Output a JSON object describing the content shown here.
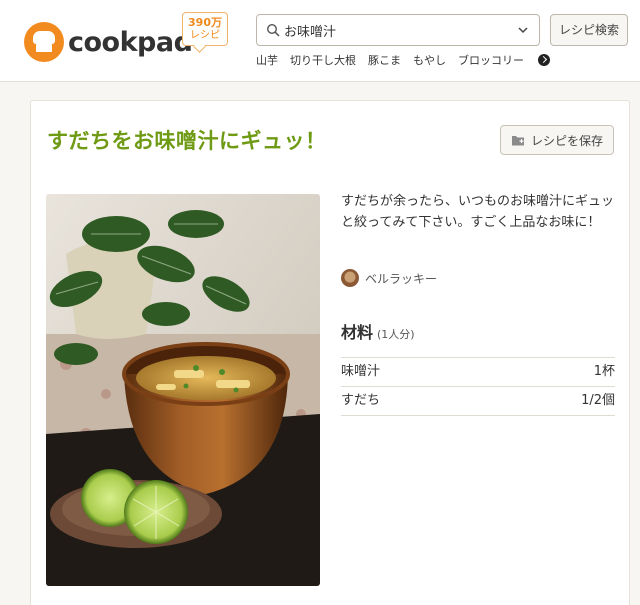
{
  "header": {
    "logo_text": "cookpad",
    "badge_line1": "390万",
    "badge_line2": "レシピ",
    "search_value": "お味噌汁",
    "search_button": "レシピ検索",
    "keywords": [
      "山芋",
      "切り干し大根",
      "豚こま",
      "もやし",
      "ブロッコリー"
    ]
  },
  "recipe": {
    "title": "すだちをお味噌汁にギュッ！",
    "save_label": "レシピを保存",
    "description": "すだちが余ったら、いつものお味噌汁にギュッと絞ってみて下さい。すごく上品なお味に！",
    "author": "ベルラッキー",
    "ingredients_heading": "材料",
    "servings": "(1人分)",
    "ingredients": [
      {
        "name": "味噌汁",
        "amount": "1杯"
      },
      {
        "name": "すだち",
        "amount": "1/2個"
      }
    ]
  }
}
